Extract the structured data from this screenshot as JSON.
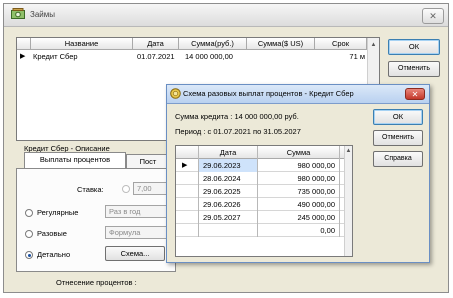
{
  "main_window": {
    "title": "Займы",
    "close_glyph": "✕",
    "grid": {
      "columns": [
        "Название",
        "Дата",
        "Сумма(руб.)",
        "Сумма($ US)",
        "Срок"
      ],
      "rows": [
        {
          "marker": "▶",
          "name": "Кредит Сбер",
          "date": "01.07.2021",
          "sum_rub": "14 000 000,00",
          "sum_usd": "",
          "term": "71 м"
        }
      ]
    },
    "buttons": {
      "ok": "ОК",
      "cancel": "Отменить"
    },
    "section_title": "Кредит Сбер - Описание",
    "tabs": {
      "payments": "Выплаты процентов",
      "post": "Пост"
    },
    "rate_label": "Ставка:",
    "rate_value": "7,00",
    "radios": {
      "regular": {
        "label": "Регулярные",
        "field": "Раз в год"
      },
      "one_time": {
        "label": "Разовые",
        "field": "Формула"
      },
      "detailed": {
        "label": "Детально",
        "button": "Схема..."
      }
    },
    "interest_relation_label": "Отнесение процентов :"
  },
  "dialog": {
    "title": "Схема разовых выплат процентов - Кредит Сбер",
    "close_glyph": "✕",
    "loan_sum": "Сумма кредита : 14 000 000,00 руб.",
    "period": "Период :   с  01.07.2021  по  31.05.2027",
    "buttons": {
      "ok": "ОК",
      "cancel": "Отменить",
      "help": "Справка"
    },
    "grid": {
      "columns": [
        "Дата",
        "Сумма"
      ],
      "current_marker": "▶",
      "rows": [
        {
          "date": "29.06.2023",
          "amount": "980 000,00"
        },
        {
          "date": "28.06.2024",
          "amount": "980 000,00"
        },
        {
          "date": "29.06.2025",
          "amount": "735 000,00"
        },
        {
          "date": "29.06.2026",
          "amount": "490 000,00"
        },
        {
          "date": "29.05.2027",
          "amount": "245 000,00"
        },
        {
          "date": "",
          "amount": "0,00"
        }
      ]
    }
  },
  "colors": {
    "window_bg": "#ece9d8",
    "dialog_title_bg": "#b9d1f0",
    "selection_blue": "#cfe3fb",
    "close_red": "#c3372a"
  },
  "icons": {
    "app": "money-icon",
    "dialog": "coin-icon"
  }
}
